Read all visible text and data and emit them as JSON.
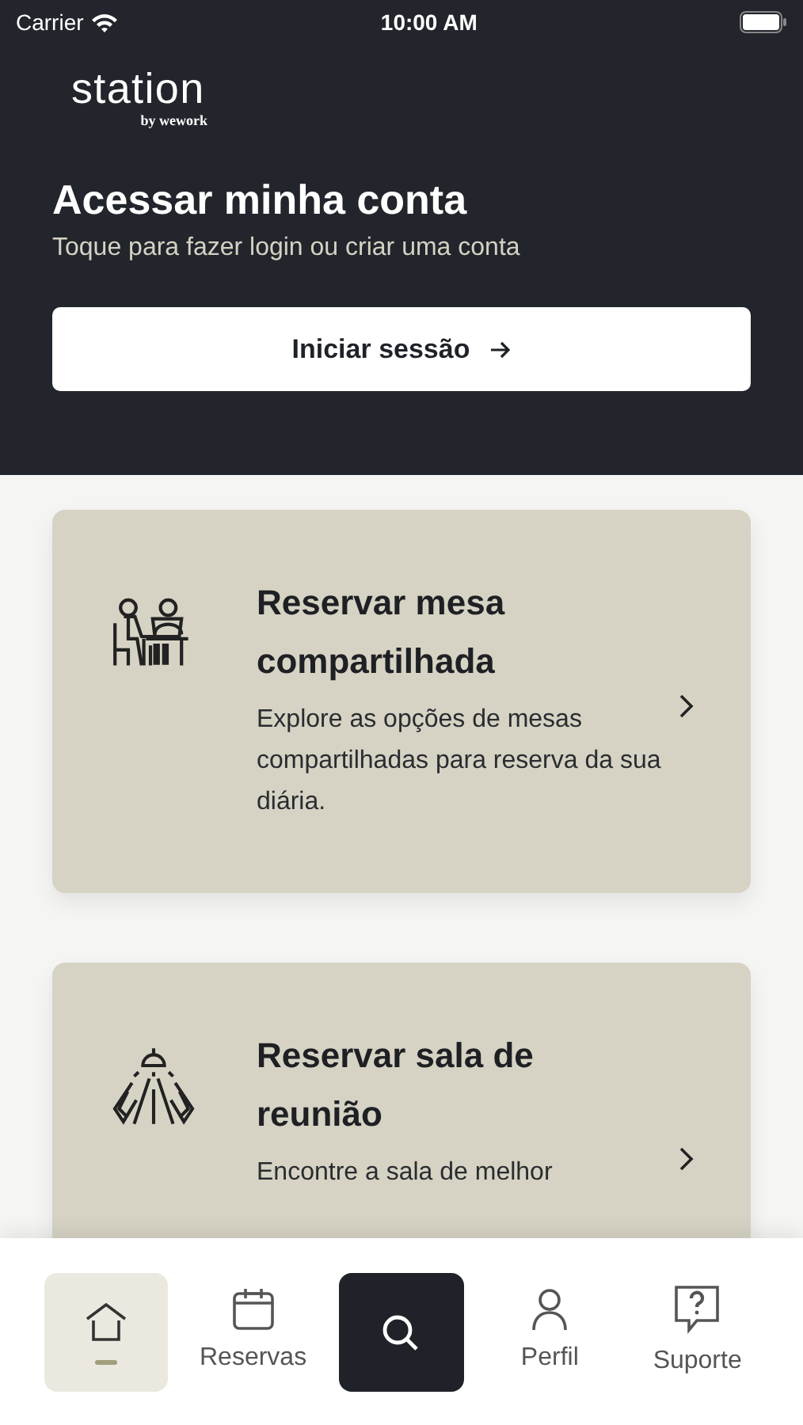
{
  "status_bar": {
    "carrier": "Carrier",
    "time": "10:00 AM"
  },
  "header": {
    "logo": "station",
    "logo_sub": "by wework",
    "title": "Acessar minha conta",
    "subtitle": "Toque para fazer login ou criar uma conta",
    "button": "Iniciar sessão"
  },
  "cards": [
    {
      "title": "Reservar mesa compartilhada",
      "text": "Explore as opções de mesas compartilhadas para reserva da sua diária."
    },
    {
      "title": "Reservar sala de reunião",
      "text": "Encontre a sala de melhor"
    }
  ],
  "nav": [
    {
      "kind": "tab",
      "selected": true
    },
    {
      "kind": "tab",
      "label": "Reservas",
      "selected": false
    },
    {
      "kind": "search",
      "selected": false
    },
    {
      "kind": "tab",
      "label": "Perfil",
      "selected": false
    },
    {
      "kind": "tab",
      "label": "Suporte",
      "selected": false
    }
  ]
}
